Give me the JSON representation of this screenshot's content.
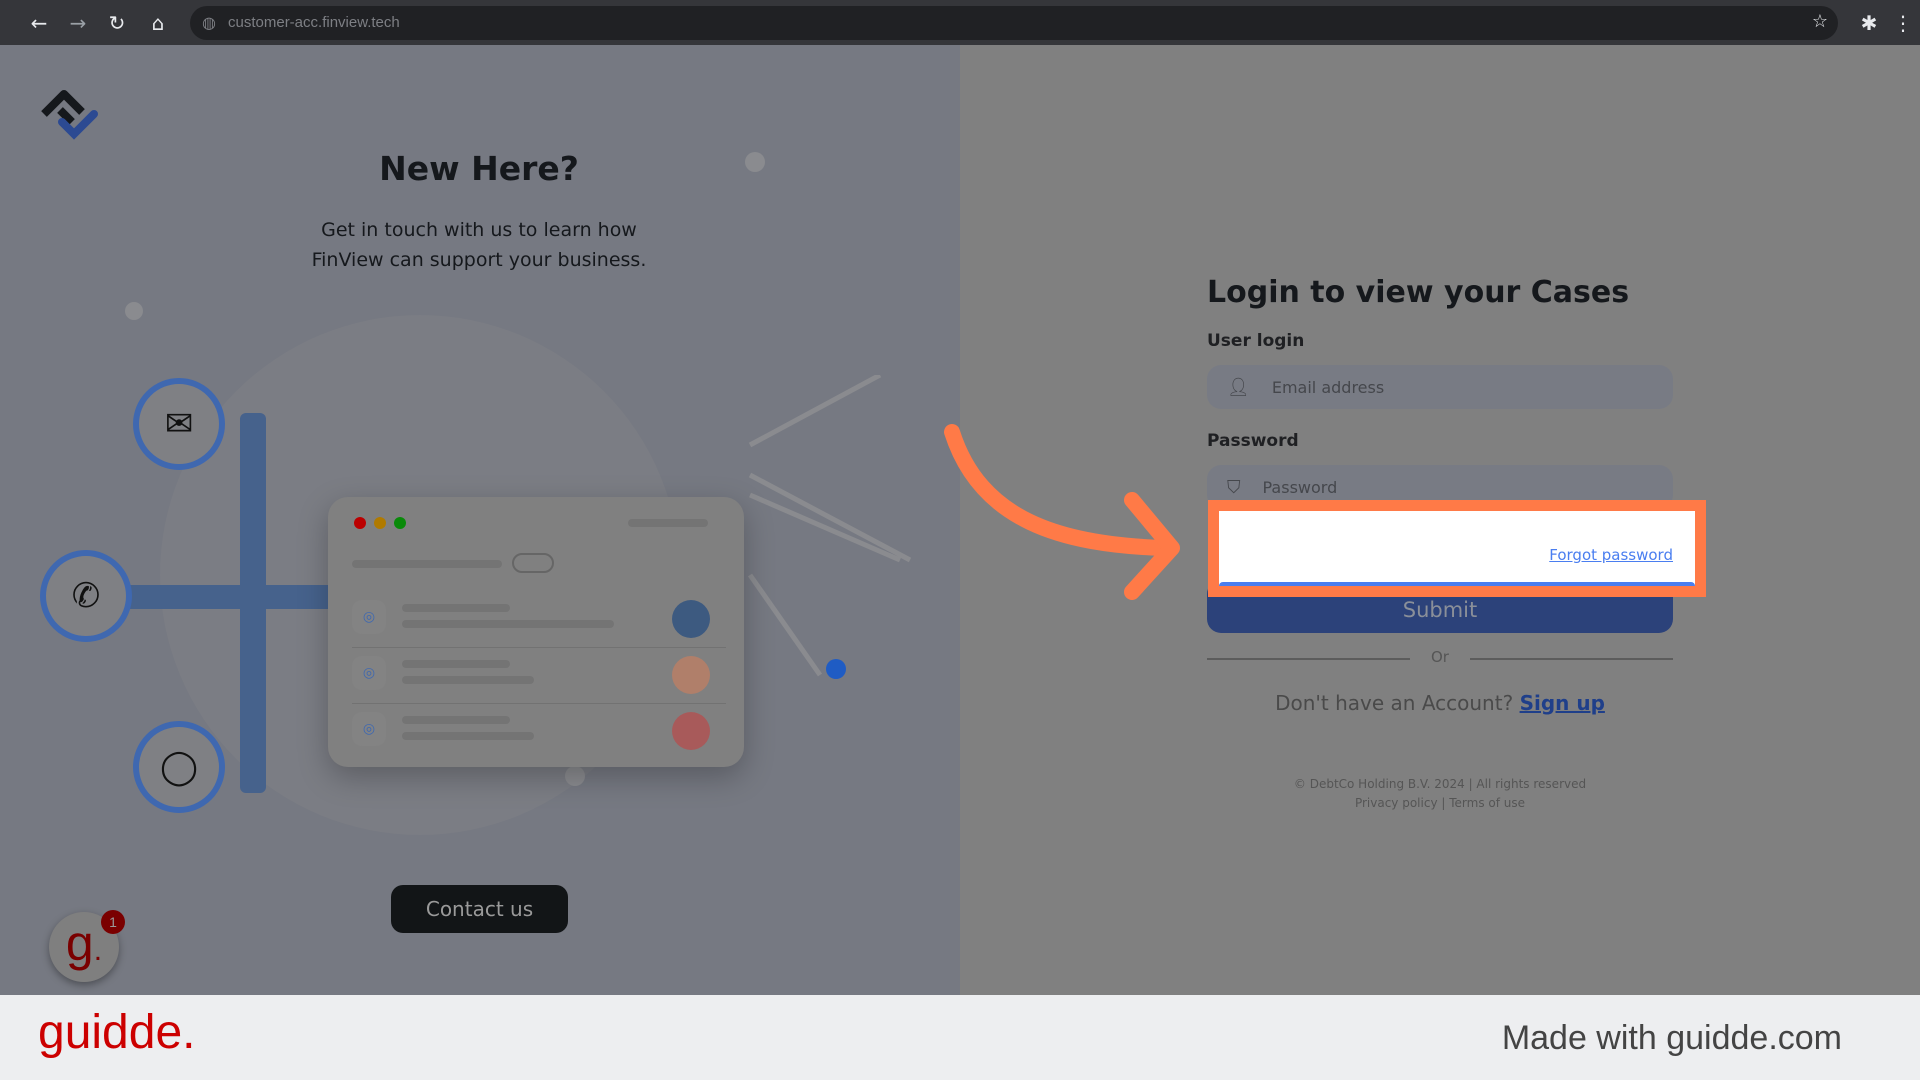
{
  "browser": {
    "url": "customer-acc.finview.tech",
    "icons": [
      "back-icon",
      "forward-icon",
      "reload-icon",
      "home-icon",
      "globe-icon",
      "star-icon",
      "extensions-icon",
      "menu-icon"
    ]
  },
  "left": {
    "title": "New Here?",
    "subtitle_line1": "Get in touch with us to learn how",
    "subtitle_line2": "FinView can support your business.",
    "contact_label": "Contact us",
    "channels": [
      "email-icon",
      "whatsapp-icon",
      "chat-icon"
    ]
  },
  "login": {
    "title": "Login to view your Cases",
    "user_label": "User login",
    "email_placeholder": "Email address",
    "password_label": "Password",
    "password_placeholder": "Password",
    "forgot": "Forgot password",
    "submit": "Submit",
    "or": "Or",
    "no_account": "Don't have an Account?",
    "signup": "Sign up",
    "copyright": "© DebtCo Holding B.V. 2024 | All rights reserved",
    "privacy": "Privacy policy",
    "sep": "|",
    "terms": "Terms of use"
  },
  "colors": {
    "accent": "#2c427a",
    "highlight": "#ff7a47",
    "link": "#4a7ef0",
    "guidde": "#cc0000"
  },
  "guidde": {
    "badge": "1",
    "logo": "guidde.",
    "made_with": "Made with guidde.com"
  }
}
